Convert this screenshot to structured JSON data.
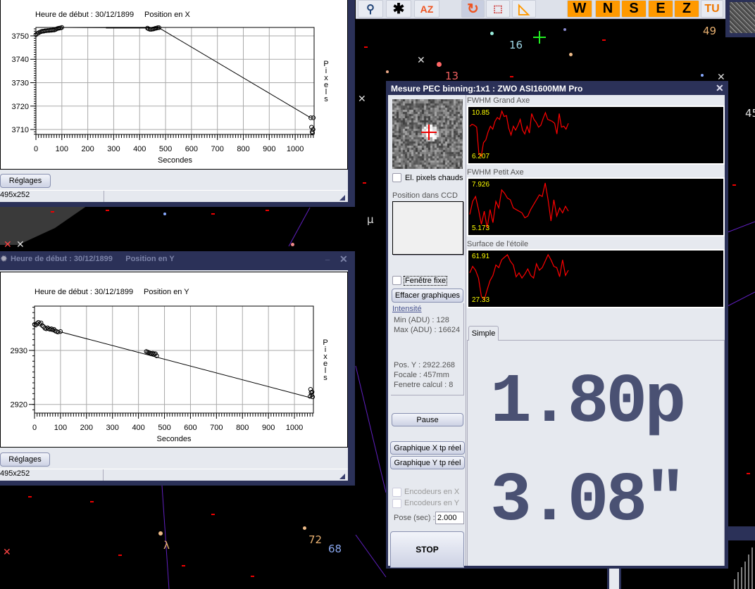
{
  "sky": {
    "labels": [
      {
        "text": "16",
        "color": "#9fd8e8"
      },
      {
        "text": "13",
        "color": "#f06060"
      },
      {
        "text": "49",
        "color": "#e8b070"
      },
      {
        "text": "45",
        "color": "#ddd"
      },
      {
        "text": "72",
        "color": "#e8b070"
      },
      {
        "text": "68",
        "color": "#8aa8f0"
      },
      {
        "text": "µ",
        "color": "#ddd"
      },
      {
        "text": "λ",
        "color": "#e8b070"
      }
    ]
  },
  "toolbar": {
    "icons": [
      "telescope-icon",
      "star-icon",
      "az-sort-icon",
      "refresh-icon",
      "selection-icon",
      "triangle-ruler-icon"
    ],
    "directions": [
      "W",
      "N",
      "S",
      "E",
      "Z"
    ],
    "extra": "TU"
  },
  "window_x": {
    "chart_title": "Heure de début : 30/12/1899",
    "series_title": "Position en X",
    "settings_label": "Réglages",
    "size_label": "495x252"
  },
  "window_y": {
    "title": "Heure de début : 30/12/1899      Position en Y",
    "chart_title": "Heure de début : 30/12/1899",
    "series_title": "Position en Y",
    "settings_label": "Réglages",
    "size_label": "495x252"
  },
  "chart_data": [
    {
      "type": "scatter",
      "title": "Position en X",
      "xlabel": "Secondes",
      "ylabel": "Pixels",
      "xlim": [
        0,
        1073
      ],
      "ylim": [
        3707.9,
        3753.6
      ],
      "xticks": [
        0,
        100,
        200,
        300,
        400,
        500,
        600,
        700,
        800,
        900,
        1000
      ],
      "yticks": [
        3710,
        3720,
        3730,
        3740,
        3750
      ],
      "grid": true,
      "segments": [
        [
          [
            270,
            3753.5
          ],
          [
            430,
            3753.5
          ]
        ]
      ],
      "line": [
        [
          100,
          3753.6
        ],
        [
          475,
          3753.4
        ],
        [
          1060,
          3715
        ]
      ],
      "points": [
        [
          0,
          3750.5
        ],
        [
          5,
          3751
        ],
        [
          10,
          3751.3
        ],
        [
          15,
          3751.6
        ],
        [
          20,
          3751.8
        ],
        [
          25,
          3752
        ],
        [
          30,
          3752
        ],
        [
          35,
          3752.2
        ],
        [
          40,
          3752.2
        ],
        [
          45,
          3752.3
        ],
        [
          50,
          3752.3
        ],
        [
          55,
          3752.4
        ],
        [
          60,
          3752.4
        ],
        [
          65,
          3752.5
        ],
        [
          70,
          3752.5
        ],
        [
          75,
          3752.7
        ],
        [
          80,
          3753
        ],
        [
          85,
          3753.2
        ],
        [
          90,
          3753.3
        ],
        [
          95,
          3753.4
        ],
        [
          100,
          3753.6
        ],
        [
          430,
          3753.3
        ],
        [
          435,
          3753
        ],
        [
          440,
          3752.8
        ],
        [
          445,
          3752.8
        ],
        [
          450,
          3752.9
        ],
        [
          455,
          3753
        ],
        [
          460,
          3753.2
        ],
        [
          465,
          3753.3
        ],
        [
          470,
          3753.5
        ],
        [
          475,
          3753.5
        ],
        [
          1060,
          3715
        ],
        [
          1063,
          3711
        ],
        [
          1065,
          3709
        ],
        [
          1067,
          3708.5
        ],
        [
          1069,
          3710
        ],
        [
          1070,
          3715
        ]
      ]
    },
    {
      "type": "scatter",
      "title": "Position en Y",
      "xlabel": "Secondes",
      "ylabel": "Pixels",
      "xlim": [
        0,
        1073
      ],
      "ylim": [
        2918.4,
        2938.2
      ],
      "xticks": [
        0,
        100,
        200,
        300,
        400,
        500,
        600,
        700,
        800,
        900,
        1000
      ],
      "yticks": [
        2920,
        2930
      ],
      "grid": true,
      "segments": [],
      "line": [
        [
          95,
          2933.5
        ],
        [
          1065,
          2921.2
        ]
      ],
      "points": [
        [
          0,
          2934.8
        ],
        [
          5,
          2934.7
        ],
        [
          10,
          2935
        ],
        [
          15,
          2935.2
        ],
        [
          20,
          2934.9
        ],
        [
          25,
          2935.1
        ],
        [
          30,
          2934.6
        ],
        [
          35,
          2934.4
        ],
        [
          40,
          2934.1
        ],
        [
          45,
          2934
        ],
        [
          50,
          2934.2
        ],
        [
          55,
          2934
        ],
        [
          60,
          2933.9
        ],
        [
          65,
          2934
        ],
        [
          70,
          2933.8
        ],
        [
          75,
          2933.9
        ],
        [
          80,
          2933.6
        ],
        [
          85,
          2933.5
        ],
        [
          90,
          2933.4
        ],
        [
          100,
          2933.5
        ],
        [
          430,
          2929.8
        ],
        [
          435,
          2929.7
        ],
        [
          440,
          2929.6
        ],
        [
          445,
          2929.5
        ],
        [
          450,
          2929.4
        ],
        [
          455,
          2929.5
        ],
        [
          460,
          2929.3
        ],
        [
          465,
          2929.4
        ],
        [
          470,
          2929
        ],
        [
          1060,
          2921.5
        ],
        [
          1062,
          2922.8
        ],
        [
          1064,
          2922.2
        ],
        [
          1066,
          2921.8
        ],
        [
          1068,
          2922.3
        ],
        [
          1070,
          2921.4
        ]
      ]
    },
    {
      "type": "line",
      "title": "FWHM Grand Axe",
      "max_label": "10.85",
      "min_label": "6.207",
      "ylim": [
        6.207,
        10.85
      ],
      "values": [
        9.3,
        9.5,
        9.4,
        9.2,
        6.4,
        6.207,
        7.6,
        7.9,
        8.7,
        9.3,
        9.0,
        9.8,
        10.2,
        10.0,
        10.85,
        10.3,
        10.4,
        9.1,
        8.4,
        9.3,
        8.9,
        9.4,
        10.0,
        8.9,
        8.5,
        9.3,
        8.6,
        10.6,
        10.0,
        9.7,
        9.2,
        9.4,
        10.1,
        10.7,
        10.0,
        9.9,
        9.8,
        9.6,
        8.5,
        10.6,
        9.2,
        9.3,
        9.0,
        9.6
      ]
    },
    {
      "type": "line",
      "title": "FWHM Petit Axe",
      "max_label": "7.926",
      "min_label": "5.173",
      "ylim": [
        5.173,
        7.926
      ],
      "values": [
        6.0,
        6.8,
        7.1,
        6.3,
        5.4,
        6.2,
        5.173,
        6.3,
        5.5,
        6.8,
        6.4,
        7.5,
        7.3,
        7.0,
        6.9,
        6.4,
        6.3,
        6.2,
        6.1,
        5.8,
        5.9,
        6.3,
        6.6,
        6.9,
        7.2,
        7.1,
        7.926,
        6.9,
        5.6,
        6.9,
        5.9,
        6.4,
        6.1,
        6.5,
        6.2
      ]
    },
    {
      "type": "line",
      "title": "Surface de l'étoile",
      "max_label": "61.91",
      "min_label": "27.33",
      "ylim": [
        27.33,
        61.91
      ],
      "values": [
        48,
        53,
        50,
        44,
        30,
        27.33,
        35,
        42,
        46,
        54,
        52,
        58,
        60,
        61.91,
        57,
        54,
        45,
        48,
        44,
        47,
        51,
        46,
        44,
        55,
        50,
        52,
        57,
        61.9,
        58,
        53,
        52,
        45,
        58,
        46,
        50
      ]
    }
  ],
  "pec": {
    "title": "Mesure PEC binning:1x1 : ZWO ASI1600MM Pro",
    "hot_pixels_label": "El. pixels chauds",
    "ccd_position_label": "Position dans CCD",
    "fixed_window_label": "Fenêtre fixe",
    "clear_graphs_label": "Effacer graphiques",
    "intensity_label": "Intensité",
    "min_adu": "Min (ADU) : 128",
    "max_adu": "Max (ADU) : 16624",
    "pos_y": "Pos. Y : 2922.268",
    "focal": "Focale : 457mm",
    "calc_window": "Fenetre calcul : 8",
    "pause_label": "Pause",
    "graph_x_label": "Graphique X tp réel",
    "graph_y_label": "Graphique Y tp réel",
    "encoder_x_label": "Encodeurs en X",
    "encoder_y_label": "Encodeurs en Y",
    "exposure_label": "Pose (sec) :",
    "exposure_value": "2.000",
    "stop_label": "STOP",
    "tab_simple": "Simple",
    "error_pixels": "1.80p",
    "error_arcsec": "3.08\""
  }
}
